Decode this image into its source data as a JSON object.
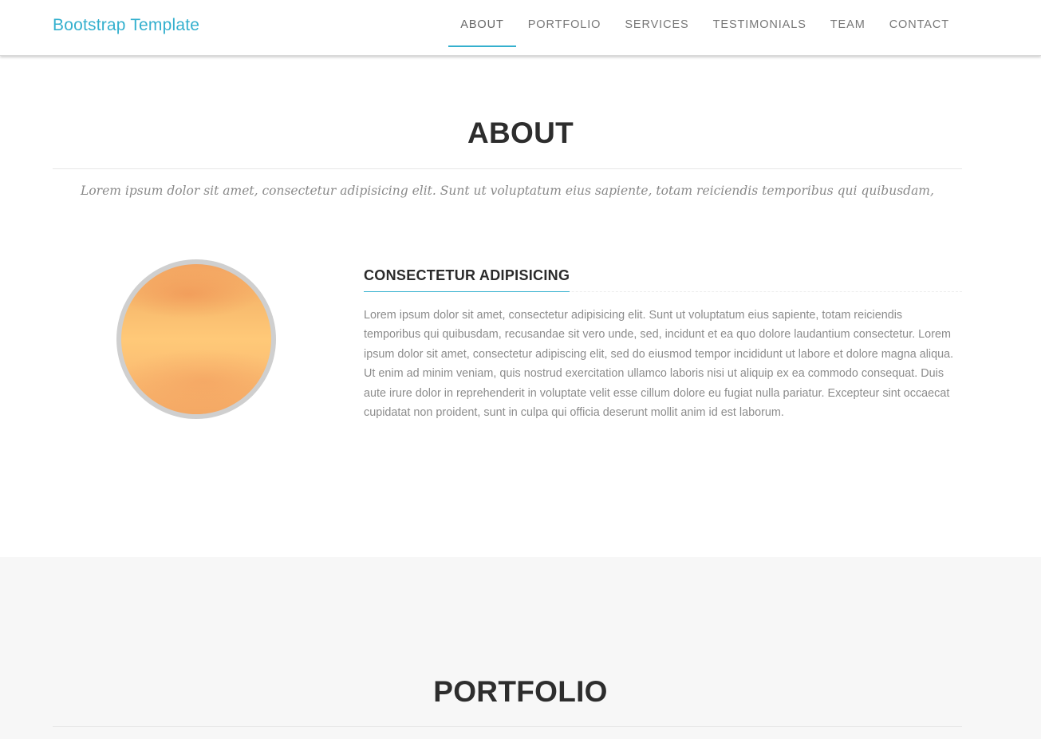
{
  "navbar": {
    "brand": "Bootstrap Template",
    "items": [
      {
        "label": "ABOUT",
        "active": true
      },
      {
        "label": "PORTFOLIO",
        "active": false
      },
      {
        "label": "SERVICES",
        "active": false
      },
      {
        "label": "TESTIMONIALS",
        "active": false
      },
      {
        "label": "TEAM",
        "active": false
      },
      {
        "label": "CONTACT",
        "active": false
      }
    ]
  },
  "about": {
    "title": "ABOUT",
    "lead": "Lorem ipsum dolor sit amet, consectetur adipisicing elit. Sunt ut voluptatum eius sapiente, totam reiciendis temporibus qui quibusdam,",
    "content_title": "CONSECTETUR ADIPISICING",
    "content_body": "Lorem ipsum dolor sit amet, consectetur adipisicing elit. Sunt ut voluptatum eius sapiente, totam reiciendis temporibus qui quibusdam, recusandae sit vero unde, sed, incidunt et ea quo dolore laudantium consectetur. Lorem ipsum dolor sit amet, consectetur adipiscing elit, sed do eiusmod tempor incididunt ut labore et dolore magna aliqua. Ut enim ad minim veniam, quis nostrud exercitation ullamco laboris nisi ut aliquip ex ea commodo consequat. Duis aute irure dolor in reprehenderit in voluptate velit esse cillum dolore eu fugiat nulla pariatur. Excepteur sint occaecat cupidatat non proident, sunt in culpa qui officia deserunt mollit anim id est laborum."
  },
  "portfolio": {
    "title": "PORTFOLIO"
  },
  "colors": {
    "accent": "#34b0ce",
    "heading": "#2d2d2d",
    "muted_text": "#8c8c8c",
    "alt_section_bg": "#f7f7f7"
  },
  "icons": {
    "about_image": "circular-gradient-image"
  }
}
